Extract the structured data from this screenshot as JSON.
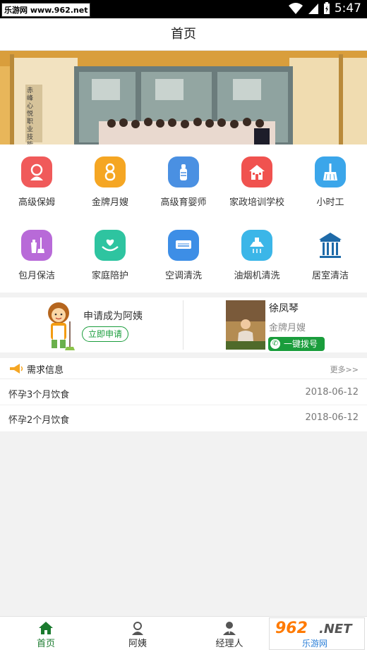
{
  "status_bar": {
    "watermark": "乐游网 www.962.net",
    "time": "5:47"
  },
  "header": {
    "title": "首页"
  },
  "banner": {
    "sign_text": "赤峰心悦职业技能"
  },
  "services": [
    {
      "label": "高级保姆",
      "icon": "nanny-icon",
      "color": "#f05a5a"
    },
    {
      "label": "金牌月嫂",
      "icon": "maternity-icon",
      "color": "#f5a623"
    },
    {
      "label": "高级育婴师",
      "icon": "baby-bottle-icon",
      "color": "#4a90e2"
    },
    {
      "label": "家政培训学校",
      "icon": "school-icon",
      "color": "#f0524f"
    },
    {
      "label": "小时工",
      "icon": "broom-icon",
      "color": "#3ba6ea"
    },
    {
      "label": "包月保洁",
      "icon": "cleaning-icon",
      "color": "#b86ad8"
    },
    {
      "label": "家庭陪护",
      "icon": "heart-hands-icon",
      "color": "#2ec4a0"
    },
    {
      "label": "空调清洗",
      "icon": "air-conditioner-icon",
      "color": "#3d8ee6"
    },
    {
      "label": "油烟机清洗",
      "icon": "range-hood-icon",
      "color": "#3bb6e8"
    },
    {
      "label": "居室清洁",
      "icon": "building-icon",
      "color": "#1e6aa8"
    }
  ],
  "apply": {
    "title": "申请成为阿姨",
    "button": "立即申请"
  },
  "worker": {
    "name": "徐凤琴",
    "title": "金牌月嫂",
    "call_button": "一键拨号"
  },
  "demand": {
    "title": "需求信息",
    "more": "更多>>",
    "items": [
      {
        "title": "怀孕3个月饮食",
        "date": "2018-06-12"
      },
      {
        "title": "怀孕2个月饮食",
        "date": "2018-06-12"
      }
    ]
  },
  "tabs": [
    {
      "label": "首页",
      "icon": "home-icon",
      "active": true
    },
    {
      "label": "阿姨",
      "icon": "nanny-tab-icon",
      "active": false
    },
    {
      "label": "经理人",
      "icon": "manager-icon",
      "active": false
    }
  ],
  "corner_watermark": {
    "num": "962",
    "net": ".NET",
    "sub": "乐游网"
  },
  "colors": {
    "accent_green": "#1a9d3c",
    "tab_active": "#1a7a2e"
  }
}
